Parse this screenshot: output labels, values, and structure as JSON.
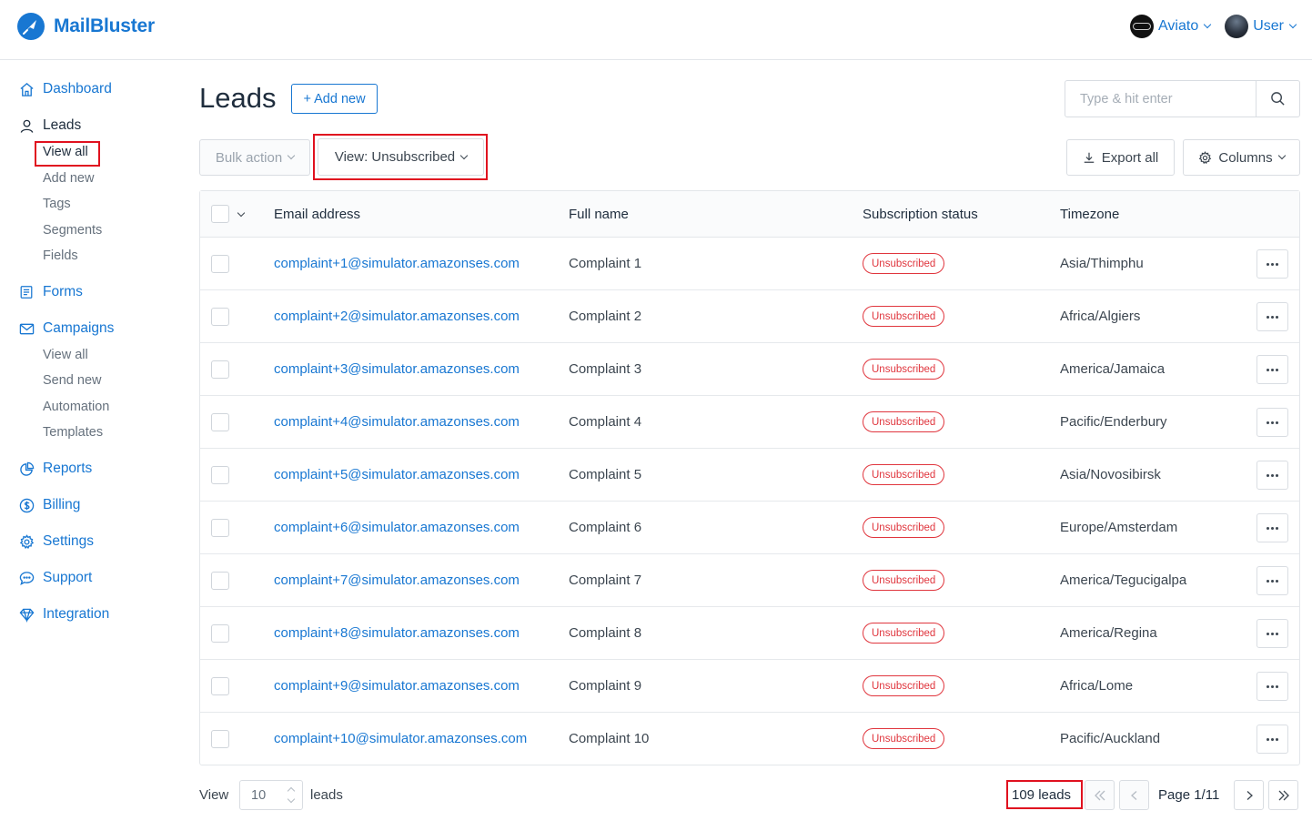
{
  "app": {
    "brand": "MailBluster",
    "brand_color": "#1877d2"
  },
  "account": {
    "org_label": "Aviato",
    "user_label": "User"
  },
  "sidebar": {
    "dashboard": "Dashboard",
    "leads": "Leads",
    "leads_sub": [
      "View all",
      "Add new",
      "Tags",
      "Segments",
      "Fields"
    ],
    "forms": "Forms",
    "campaigns": "Campaigns",
    "campaigns_sub": [
      "View all",
      "Send new",
      "Automation",
      "Templates"
    ],
    "reports": "Reports",
    "billing": "Billing",
    "settings": "Settings",
    "support": "Support",
    "integration": "Integration"
  },
  "header": {
    "title": "Leads",
    "add_new_label": "+ Add new"
  },
  "search": {
    "placeholder": "Type & hit enter"
  },
  "toolbar": {
    "bulk_action": "Bulk action",
    "view_filter": "View: Unsubscribed",
    "export_all": "Export all",
    "columns": "Columns"
  },
  "table": {
    "columns": [
      "Email address",
      "Full name",
      "Subscription status",
      "Timezone"
    ],
    "rows": [
      {
        "email": "complaint+1@simulator.amazonses.com",
        "name": "Complaint 1",
        "status": "Unsubscribed",
        "timezone": "Asia/Thimphu"
      },
      {
        "email": "complaint+2@simulator.amazonses.com",
        "name": "Complaint 2",
        "status": "Unsubscribed",
        "timezone": "Africa/Algiers"
      },
      {
        "email": "complaint+3@simulator.amazonses.com",
        "name": "Complaint 3",
        "status": "Unsubscribed",
        "timezone": "America/Jamaica"
      },
      {
        "email": "complaint+4@simulator.amazonses.com",
        "name": "Complaint 4",
        "status": "Unsubscribed",
        "timezone": "Pacific/Enderbury"
      },
      {
        "email": "complaint+5@simulator.amazonses.com",
        "name": "Complaint 5",
        "status": "Unsubscribed",
        "timezone": "Asia/Novosibirsk"
      },
      {
        "email": "complaint+6@simulator.amazonses.com",
        "name": "Complaint 6",
        "status": "Unsubscribed",
        "timezone": "Europe/Amsterdam"
      },
      {
        "email": "complaint+7@simulator.amazonses.com",
        "name": "Complaint 7",
        "status": "Unsubscribed",
        "timezone": "America/Tegucigalpa"
      },
      {
        "email": "complaint+8@simulator.amazonses.com",
        "name": "Complaint 8",
        "status": "Unsubscribed",
        "timezone": "America/Regina"
      },
      {
        "email": "complaint+9@simulator.amazonses.com",
        "name": "Complaint 9",
        "status": "Unsubscribed",
        "timezone": "Africa/Lome"
      },
      {
        "email": "complaint+10@simulator.amazonses.com",
        "name": "Complaint 10",
        "status": "Unsubscribed",
        "timezone": "Pacific/Auckland"
      }
    ]
  },
  "footer": {
    "view_label": "View",
    "per_page": "10",
    "leads_label": "leads",
    "total": "109 leads",
    "page": "Page 1/11"
  }
}
